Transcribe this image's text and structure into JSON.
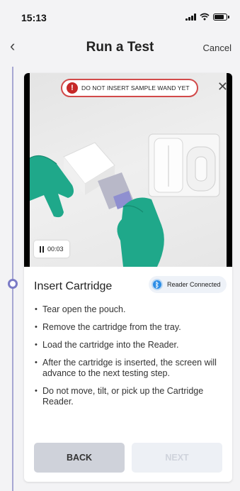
{
  "status_bar": {
    "time": "15:13",
    "icons": [
      "signal-icon",
      "wifi-icon",
      "battery-icon"
    ]
  },
  "nav": {
    "back_icon": "chevron-left-icon",
    "title": "Run a Test",
    "cancel_label": "Cancel"
  },
  "video": {
    "warning_text": "DO NOT INSERT SAMPLE WAND YET",
    "warning_icon": "!",
    "close_icon": "close-icon",
    "elapsed": "00:03"
  },
  "step": {
    "title": "Insert Cartridge",
    "reader_status": "Reader Connected",
    "reader_icon": "bluetooth-icon",
    "instructions": [
      "Tear open the pouch.",
      "Remove the cartridge from the tray.",
      "Load the cartridge into the Reader.",
      "After the cartridge is inserted, the screen will advance to the next testing step.",
      "Do not move, tilt, or pick up the Cartridge Reader."
    ]
  },
  "buttons": {
    "back_label": "BACK",
    "next_label": "NEXT"
  },
  "colors": {
    "timeline": "#a6a6d3",
    "warning_red": "#c62828",
    "bluetooth_blue": "#2e8ee6",
    "glove_green": "#1fa88a"
  }
}
